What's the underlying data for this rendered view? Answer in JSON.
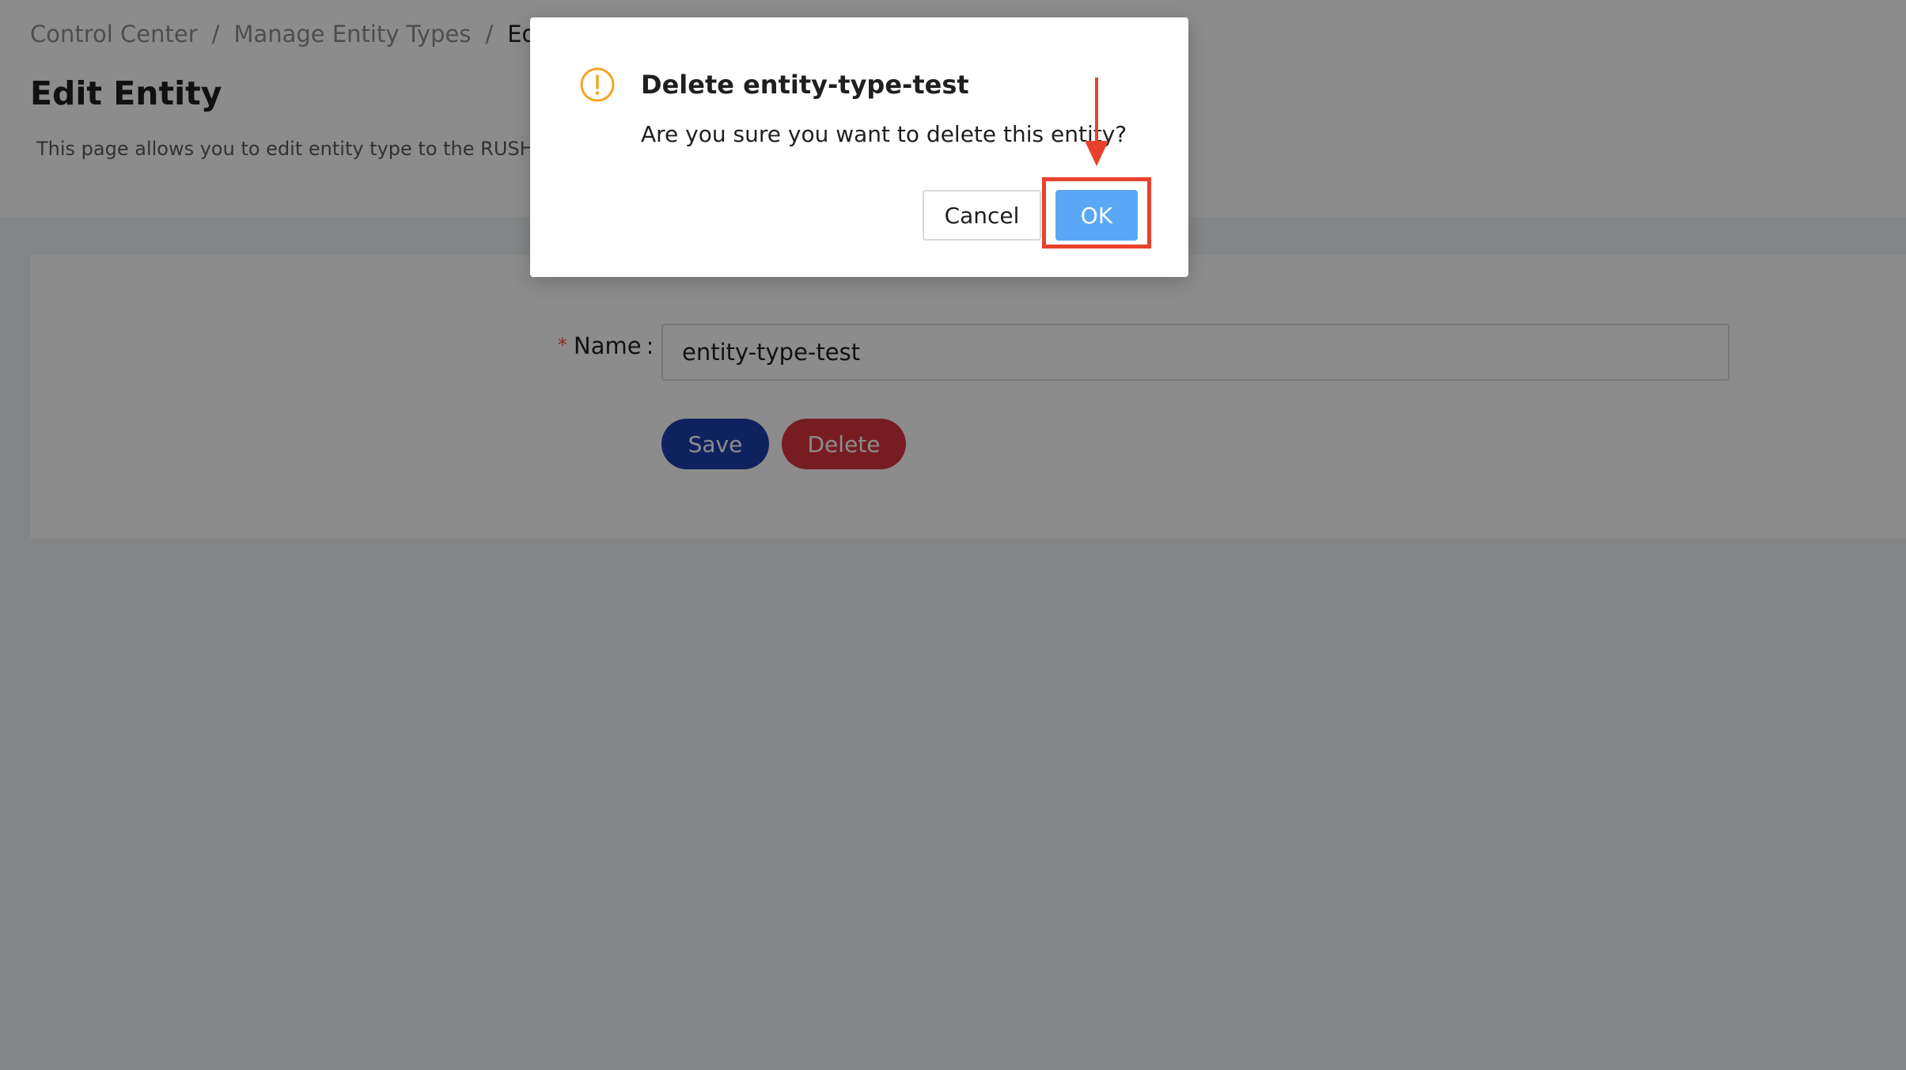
{
  "breadcrumb": {
    "items": [
      "Control Center",
      "Manage Entity Types",
      "Edi"
    ],
    "separator": "/"
  },
  "page": {
    "title": "Edit Entity",
    "description": "This page allows you to edit entity type to the RUSH"
  },
  "form": {
    "required_mark": "*",
    "name_label": "Name",
    "label_colon": ":",
    "name_value": "entity-type-test",
    "save_label": "Save",
    "delete_label": "Delete"
  },
  "modal": {
    "icon": "exclamation-circle-icon",
    "title": "Delete entity-type-test",
    "content": "Are you sure you want to delete this entity?",
    "cancel_label": "Cancel",
    "ok_label": "OK"
  },
  "colors": {
    "primary_button": "#1d3fb0",
    "danger_button": "#d9363e",
    "ok_button": "#5aa8f5",
    "warning_icon": "#f5a623",
    "annotation": "#e8412c"
  }
}
